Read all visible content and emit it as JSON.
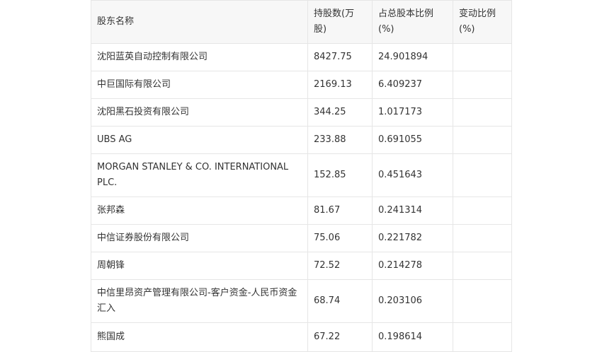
{
  "table": {
    "headers": [
      "股东名称",
      "持股数(万股)",
      "占总股本比例(%)",
      "变动比例(%)"
    ],
    "rows": [
      {
        "name": "沈阳蓝英自动控制有限公司",
        "shares": "8427.75",
        "ratio": "24.901894",
        "change": ""
      },
      {
        "name": "中巨国际有限公司",
        "shares": "2169.13",
        "ratio": "6.409237",
        "change": ""
      },
      {
        "name": "沈阳黑石投资有限公司",
        "shares": "344.25",
        "ratio": "1.017173",
        "change": ""
      },
      {
        "name": "UBS AG",
        "shares": "233.88",
        "ratio": "0.691055",
        "change": ""
      },
      {
        "name": "MORGAN STANLEY & CO. INTERNATIONAL PLC.",
        "shares": "152.85",
        "ratio": "0.451643",
        "change": ""
      },
      {
        "name": "张邦森",
        "shares": "81.67",
        "ratio": "0.241314",
        "change": ""
      },
      {
        "name": "中信证券股份有限公司",
        "shares": "75.06",
        "ratio": "0.221782",
        "change": ""
      },
      {
        "name": "周朝锋",
        "shares": "72.52",
        "ratio": "0.214278",
        "change": ""
      },
      {
        "name": "中信里昂资产管理有限公司-客户资金-人民币资金汇入",
        "shares": "68.74",
        "ratio": "0.203106",
        "change": ""
      },
      {
        "name": "熊国成",
        "shares": "67.22",
        "ratio": "0.198614",
        "change": ""
      }
    ]
  }
}
